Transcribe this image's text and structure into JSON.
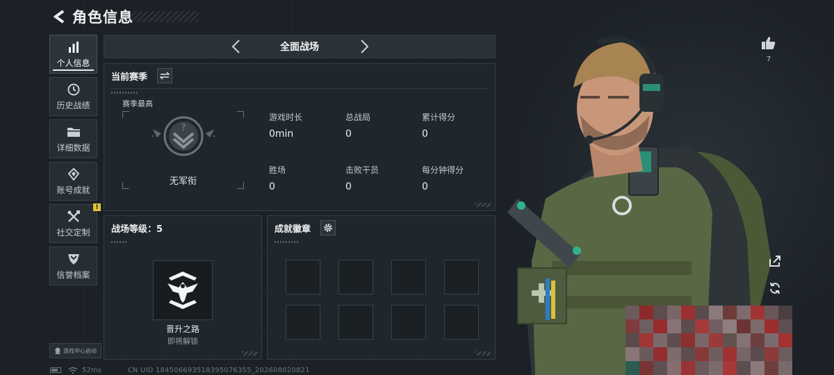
{
  "header": {
    "title": "角色信息"
  },
  "sidebar": {
    "items": [
      {
        "label": "个人信息",
        "icon": "bar-chart-icon",
        "active": true
      },
      {
        "label": "历史战绩",
        "icon": "clock-icon"
      },
      {
        "label": "详细数据",
        "icon": "folder-icon"
      },
      {
        "label": "账号成就",
        "icon": "achievement-icon"
      },
      {
        "label": "社交定制",
        "icon": "tools-icon",
        "badge": "!"
      },
      {
        "label": "信誉档案",
        "icon": "shield-icon"
      }
    ],
    "game_center_label": "游戏中心启动"
  },
  "status": {
    "ping": "52ms",
    "uid": "CN UID 18450669351839507635​5_202608020821"
  },
  "mode_selector": {
    "title": "全面战场"
  },
  "season": {
    "title": "当前赛季",
    "season_high_label": "赛季最高",
    "rank_name": "无军衔",
    "stats": [
      {
        "label": "游戏时长",
        "value": "0min"
      },
      {
        "label": "总战局",
        "value": "0"
      },
      {
        "label": "累计得分",
        "value": "0"
      },
      {
        "label": "胜场",
        "value": "0"
      },
      {
        "label": "击败干员",
        "value": "0"
      },
      {
        "label": "每分钟得分",
        "value": "0"
      }
    ]
  },
  "level": {
    "title": "战场等级：5",
    "name": "晋升之路",
    "status": "即将解锁"
  },
  "achievements": {
    "title": "成就徽章",
    "slots": 8
  },
  "profile": {
    "likes": "7"
  },
  "colors": {
    "background": "#1b2126",
    "panel": "#20272c",
    "border": "#353d44",
    "accent": "#e3c33a"
  }
}
